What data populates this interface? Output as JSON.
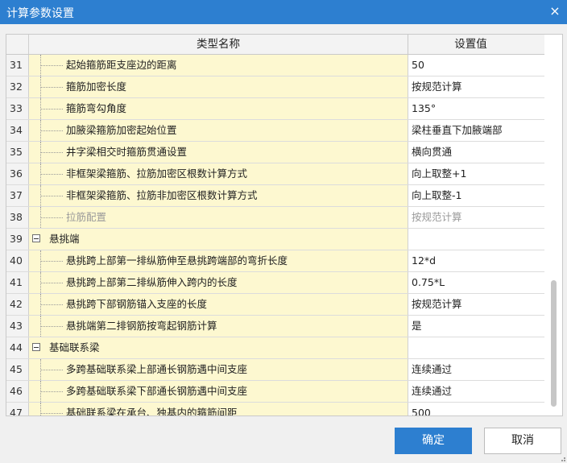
{
  "window": {
    "title": "计算参数设置",
    "close_glyph": "×"
  },
  "table": {
    "headers": {
      "name": "类型名称",
      "value": "设置值"
    },
    "rows": [
      {
        "num": "31",
        "name": "起始箍筋距支座边的距离",
        "value": "50"
      },
      {
        "num": "32",
        "name": "箍筋加密长度",
        "value": "按规范计算"
      },
      {
        "num": "33",
        "name": "箍筋弯勾角度",
        "value": "135°"
      },
      {
        "num": "34",
        "name": "加腋梁箍筋加密起始位置",
        "value": "梁柱垂直下加腋端部"
      },
      {
        "num": "35",
        "name": "井字梁相交时箍筋贯通设置",
        "value": "横向贯通"
      },
      {
        "num": "36",
        "name": "非框架梁箍筋、拉筋加密区根数计算方式",
        "value": "向上取整+1"
      },
      {
        "num": "37",
        "name": "非框架梁箍筋、拉筋非加密区根数计算方式",
        "value": "向上取整-1"
      },
      {
        "num": "38",
        "name": "拉筋配置",
        "value": "按规范计算",
        "disabled": true
      },
      {
        "num": "39",
        "name": "悬挑端",
        "value": "",
        "group": true
      },
      {
        "num": "40",
        "name": "悬挑跨上部第一排纵筋伸至悬挑跨端部的弯折长度",
        "value": "12*d"
      },
      {
        "num": "41",
        "name": "悬挑跨上部第二排纵筋伸入跨内的长度",
        "value": "0.75*L"
      },
      {
        "num": "42",
        "name": "悬挑跨下部钢筋锚入支座的长度",
        "value": "按规范计算"
      },
      {
        "num": "43",
        "name": "悬挑端第二排钢筋按弯起钢筋计算",
        "value": "是"
      },
      {
        "num": "44",
        "name": "基础联系梁",
        "value": "",
        "group": true
      },
      {
        "num": "45",
        "name": "多跨基础联系梁上部通长钢筋遇中间支座",
        "value": "连续通过"
      },
      {
        "num": "46",
        "name": "多跨基础联系梁下部通长钢筋遇中间支座",
        "value": "连续通过"
      },
      {
        "num": "47",
        "name": "基础联系梁在承台、独基内的箍筋间距",
        "value": "500"
      }
    ]
  },
  "buttons": {
    "ok": "确定",
    "cancel": "取消"
  },
  "colors": {
    "titlebar": "#2d7fd0",
    "name_column_bg": "#fdf8d0",
    "ok_button": "#2d7fd0"
  },
  "icons": {
    "close": "close-icon",
    "expander": "collapse-icon",
    "resize": "resize-grip-icon"
  },
  "scroll": {
    "thumb_position_fraction": 0.66
  }
}
